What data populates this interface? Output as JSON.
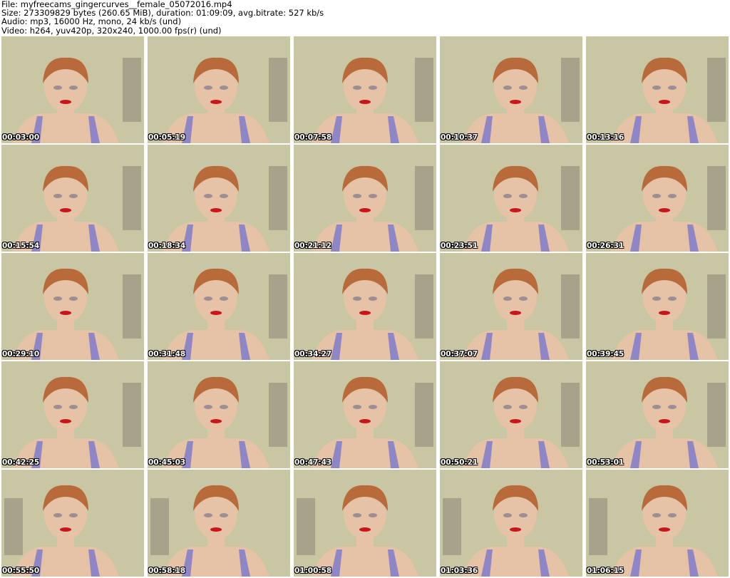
{
  "header": {
    "file_line": "File: myfreecams_gingercurves__female_05072016.mp4",
    "size_line": "Size: 273309829 bytes (260.65 MiB), duration: 01:09:09, avg.bitrate: 527 kb/s",
    "audio_line": "Audio: mp3, 16000 Hz, mono, 24 kb/s (und)",
    "video_line": "Video: h264, yuv420p, 320x240, 1000.00 fps(r) (und)"
  },
  "thumbnails": [
    {
      "timestamp": "00:03:00"
    },
    {
      "timestamp": "00:05:19"
    },
    {
      "timestamp": "00:07:58"
    },
    {
      "timestamp": "00:10:37"
    },
    {
      "timestamp": "00:13:16"
    },
    {
      "timestamp": "00:15:54"
    },
    {
      "timestamp": "00:18:34"
    },
    {
      "timestamp": "00:21:12"
    },
    {
      "timestamp": "00:23:51"
    },
    {
      "timestamp": "00:26:31"
    },
    {
      "timestamp": "00:29:10"
    },
    {
      "timestamp": "00:31:48"
    },
    {
      "timestamp": "00:34:27"
    },
    {
      "timestamp": "00:37:07"
    },
    {
      "timestamp": "00:39:45"
    },
    {
      "timestamp": "00:42:25"
    },
    {
      "timestamp": "00:45:03"
    },
    {
      "timestamp": "00:47:43"
    },
    {
      "timestamp": "00:50:21"
    },
    {
      "timestamp": "00:53:01"
    },
    {
      "timestamp": "00:55:50"
    },
    {
      "timestamp": "00:58:18"
    },
    {
      "timestamp": "01:00:58"
    },
    {
      "timestamp": "01:03:36"
    },
    {
      "timestamp": "01:06:15"
    }
  ],
  "colors": {
    "wall": "#c9c6a4",
    "skin": "#e6c2a6",
    "hair": "#b86a3a",
    "top": "#8f86c6",
    "lips": "#c8161c",
    "blinds": "#8a8774"
  }
}
